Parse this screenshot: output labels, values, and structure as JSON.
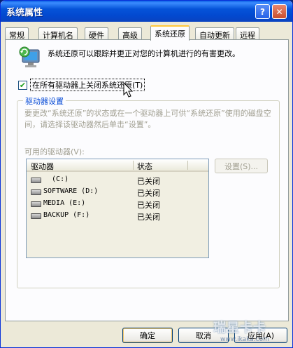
{
  "window": {
    "title": "系统属性"
  },
  "titlebar": {
    "help_label": "?",
    "close_label": "✕"
  },
  "tabs": [
    {
      "label": "常规"
    },
    {
      "label": "计算机名"
    },
    {
      "label": "硬件"
    },
    {
      "label": "高级"
    },
    {
      "label": "系统还原",
      "active": true
    },
    {
      "label": "自动更新"
    },
    {
      "label": "远程"
    }
  ],
  "intro": {
    "icon": "system-restore-icon",
    "text": "系统还原可以跟踪并更正对您的计算机进行的有害更改。"
  },
  "turn_off_checkbox": {
    "checked": true,
    "check_mark": "✔",
    "label": "在所有驱动器上关闭系统还原(T)"
  },
  "drive_settings": {
    "title": "驱动器设置",
    "description": "要更改“系统还原”的状态或在一个驱动器上可供“系统还原”使用的磁盘空间，请选择该驱动器然后单击“设置”。",
    "available_label": "可用的驱动器(V):",
    "columns": {
      "drive": "驱动器",
      "status": "状态"
    },
    "drives": [
      {
        "name": "  (C:)",
        "status": "已关闭"
      },
      {
        "name": "SOFTWARE (D:)",
        "status": "已关闭"
      },
      {
        "name": "MEDIA (E:)",
        "status": "已关闭"
      },
      {
        "name": "BACKUP (F:)",
        "status": "已关闭"
      }
    ],
    "settings_button": "设置(S)..."
  },
  "buttons": {
    "ok": "确定",
    "cancel": "取消",
    "apply": "应用(A)"
  },
  "watermark": {
    "text": "瑞星卡卡",
    "url": "www.ikaka.com"
  },
  "colors": {
    "accent": "#0046D5",
    "title_bar": "#0553D8",
    "tab_highlight": "#FFC83C"
  }
}
